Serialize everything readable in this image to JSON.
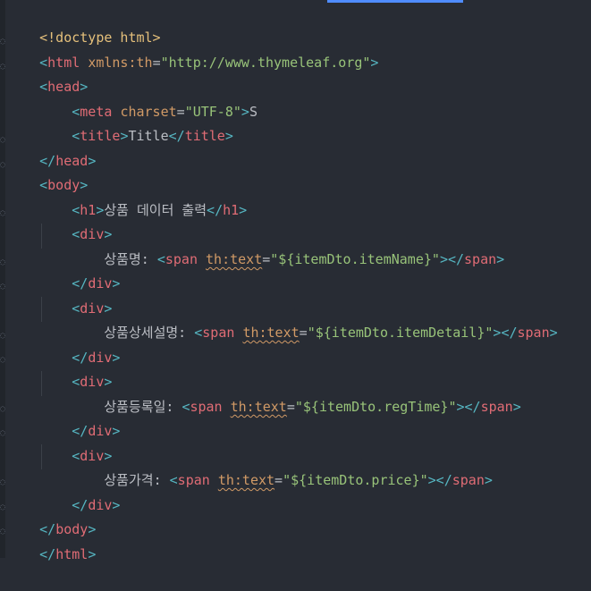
{
  "lines": {
    "doctype": "<!doctype html>",
    "html_open_start": "<",
    "html_open_name": "html",
    "html_attr_name": "xmlns:th",
    "html_attr_eq": "=",
    "html_attr_value": "\"http://www.thymeleaf.org\"",
    "html_open_end": ">",
    "head_open_start": "<",
    "head_open_name": "head",
    "head_open_end": ">",
    "meta_open_start": "<",
    "meta_name": "meta",
    "meta_attr_name": "charset",
    "meta_attr_eq": "=",
    "meta_attr_value": "\"UTF-8\"",
    "meta_open_end": ">",
    "meta_trailing": "S",
    "title_open_start": "<",
    "title_name": "title",
    "title_open_end": ">",
    "title_text": "Title",
    "title_close_start": "</",
    "title_close_name": "title",
    "title_close_end": ">",
    "head_close_start": "</",
    "head_close_name": "head",
    "head_close_end": ">",
    "body_open_start": "<",
    "body_open_name": "body",
    "body_open_end": ">",
    "h1_open_start": "<",
    "h1_open_name": "h1",
    "h1_open_end": ">",
    "h1_text": "상품 데이터 출력",
    "h1_close_start": "</",
    "h1_close_name": "h1",
    "h1_close_end": ">",
    "div_open_start": "<",
    "div_name": "div",
    "div_open_end": ">",
    "div_close_start": "</",
    "div_close_end": ">",
    "item1_label": "상품명: ",
    "item2_label": "상품상세설명: ",
    "item3_label": "상품등록일: ",
    "item4_label": "상품가격: ",
    "span_open_start": "<",
    "span_name": "span",
    "span_attr_name": "th:text",
    "span_attr_eq": "=",
    "item1_value": "\"${itemDto.itemName}\"",
    "item2_value": "\"${itemDto.itemDetail}\"",
    "item3_value": "\"${itemDto.regTime}\"",
    "item4_value": "\"${itemDto.price}\"",
    "span_open_end": ">",
    "span_close_start": "</",
    "span_close_end": ">",
    "body_close_start": "</",
    "body_close_name": "body",
    "body_close_end": ">",
    "html_close_start": "</",
    "html_close_name": "html",
    "html_close_end": ">"
  }
}
